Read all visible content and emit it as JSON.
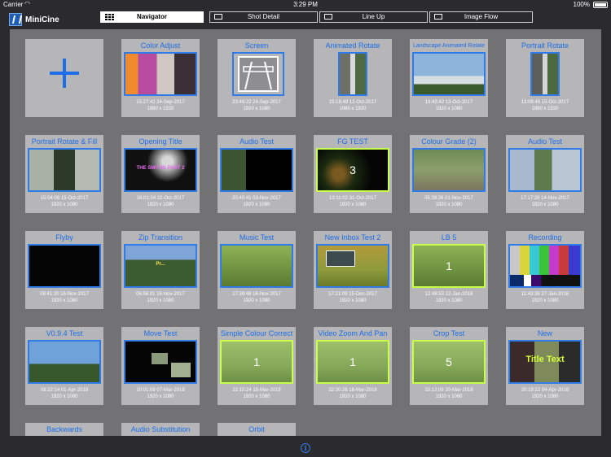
{
  "status_bar": {
    "carrier": "Carrier",
    "time": "3:29 PM",
    "battery": "100%"
  },
  "app": {
    "title": "MiniCine"
  },
  "tabs": [
    {
      "label": "Navigator",
      "active": true
    },
    {
      "label": "Shot Detail",
      "active": false
    },
    {
      "label": "Line Up",
      "active": false
    },
    {
      "label": "Image Flow",
      "active": false
    }
  ],
  "thumb_text": {
    "opening_title": "THE SMITHS PART 2",
    "fg_test": "3",
    "zip": "Pr...",
    "count_1": "1",
    "count_5": "5",
    "title_text": "Title Text"
  },
  "cards": [
    {
      "title": "Color Adjust",
      "date": "15:27:42 24-Sep-2017",
      "size": "1080 x 1920"
    },
    {
      "title": "Screen",
      "date": "23:49:22 24-Sep-2017",
      "size": "1920 x 1080"
    },
    {
      "title": "Animated Rotate",
      "date": "15:18:49 12-Oct-2017",
      "size": "1080 x 1920"
    },
    {
      "title": "Landscape Animated Rotate",
      "date": "13:43:42 13-Oct-2017",
      "size": "1920 x 1080"
    },
    {
      "title": "Portrait Rotate",
      "date": "13:06:45 15-Oct-2017",
      "size": "1080 x 1920"
    },
    {
      "title": "Portrait Rotate & Fill",
      "date": "15:04:08 15-Oct-2017",
      "size": "1920 x 1080"
    },
    {
      "title": "Opening Title",
      "date": "16:01:04 22-Oct-2017",
      "size": "1920 x 1080"
    },
    {
      "title": "Audio Test",
      "date": "20:40:41 03-Nov-2017",
      "size": "1920 x 1080"
    },
    {
      "title": "FG TEST",
      "date": "13:11:02 31-Oct-2017",
      "size": "1920 x 1080"
    },
    {
      "title": "Colour Grade (2)",
      "date": "05:39:26 01-Nov-2017",
      "size": "1920 x 1080"
    },
    {
      "title": "Audio Test",
      "date": "17:17:28 14-Nov-2017",
      "size": "1920 x 1080"
    },
    {
      "title": "Flyby",
      "date": "08:41:20 16-Nov-2017",
      "size": "1920 x 1080"
    },
    {
      "title": "Zip Transition",
      "date": "06:56:01 16-Nov-2017",
      "size": "1920 x 1080"
    },
    {
      "title": "Music Test",
      "date": "17:39:48 16-Nov-2017",
      "size": "1920 x 1080"
    },
    {
      "title": "New Inbox Test 2",
      "date": "17:21:09 15-Dec-2017",
      "size": "1920 x 1080"
    },
    {
      "title": "LB 5",
      "date": "12:48:53 22-Jan-2018",
      "size": "1920 x 1080"
    },
    {
      "title": "Recording",
      "date": "11:43:38 27-Jan-2018",
      "size": "1920 x 1080"
    },
    {
      "title": "V0.9.4 Test",
      "date": "08:22:14 01-Apr-2018",
      "size": "1920 x 1080"
    },
    {
      "title": "Move Test",
      "date": "10:01:09 07-Mar-2018",
      "size": "1920 x 1080"
    },
    {
      "title": "Simple Colour Correct",
      "date": "22:10:24 18-Mar-2018",
      "size": "1920 x 1080"
    },
    {
      "title": "Video Zoom And Pan",
      "date": "22:20:26 18-Mar-2018",
      "size": "1920 x 1080"
    },
    {
      "title": "Crop Test",
      "date": "15:12:08 20-Mar-2018",
      "size": "1920 x 1080"
    },
    {
      "title": "New",
      "date": "20:19:22 04-Apr-2018",
      "size": "1920 x 1080"
    },
    {
      "title": "Backwards"
    },
    {
      "title": "Audio Substitution"
    },
    {
      "title": "Orbit"
    }
  ],
  "colors": {
    "accent": "#1d6ee6",
    "thumb_border": "#2f7be8",
    "selected_border": "#c8ff4a",
    "panel": "#727274",
    "card": "#b6b6b8"
  }
}
